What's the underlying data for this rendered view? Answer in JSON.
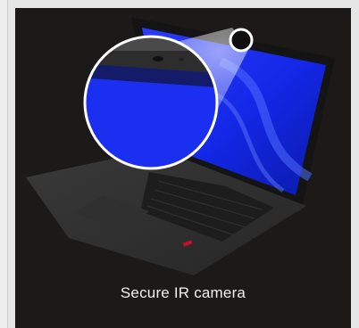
{
  "feature_card": {
    "caption": "Secure IR camera",
    "image_icon": "laptop-with-magnified-camera-icon",
    "colors": {
      "card_background": "#1b1a19",
      "screen_blue": "#1f3cff",
      "page_background": "#e6e6e6"
    }
  }
}
